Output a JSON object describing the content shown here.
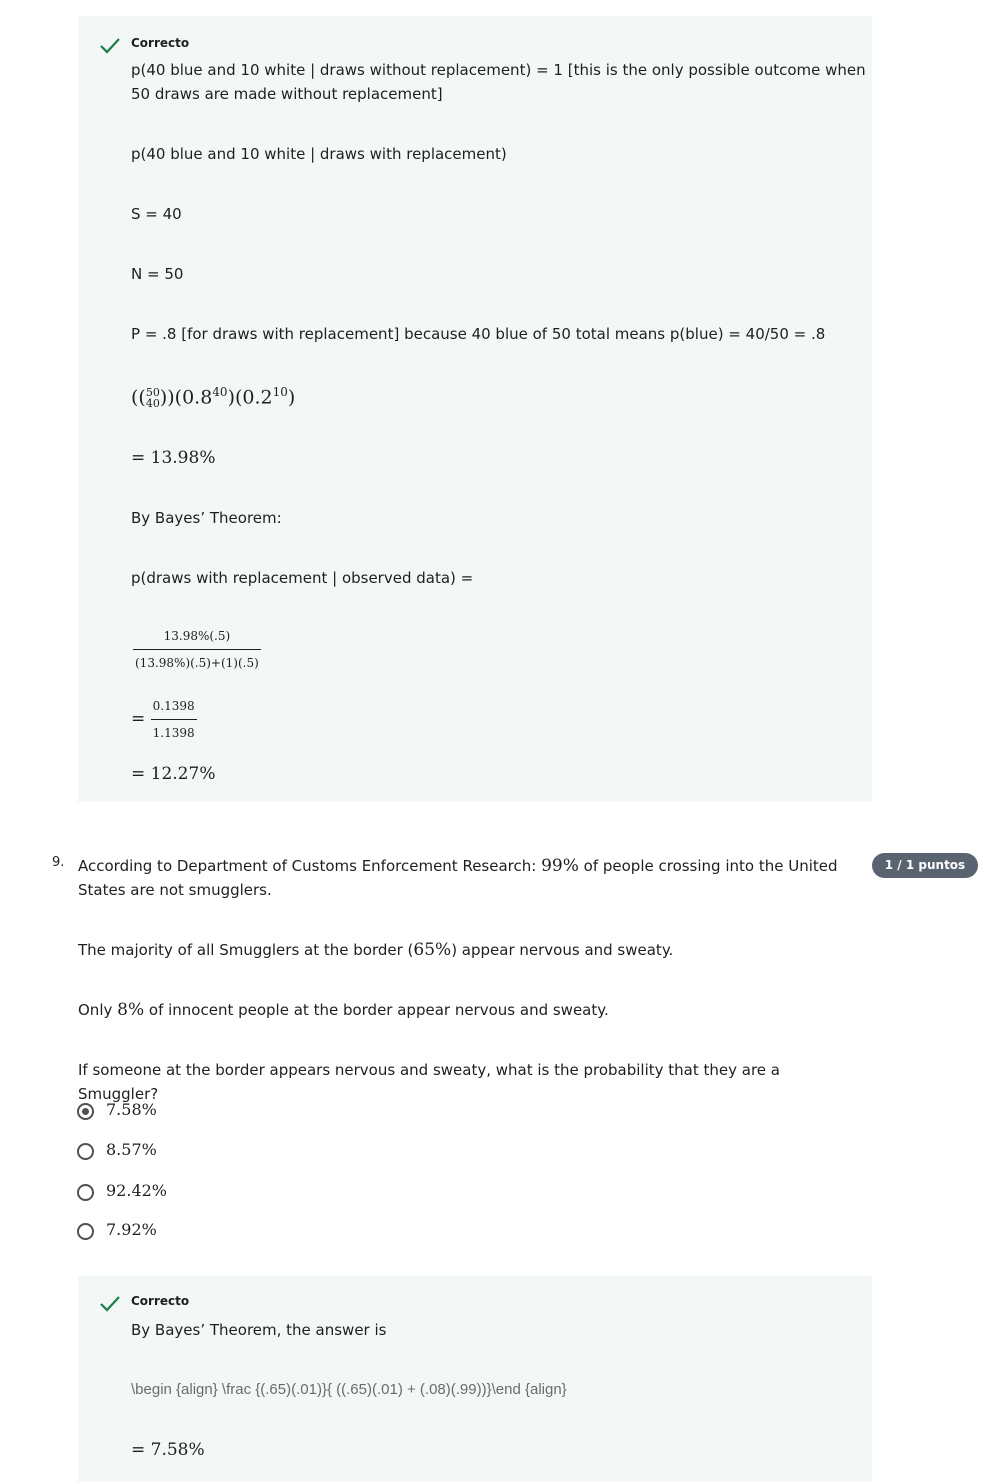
{
  "feedback1": {
    "status": "Correcto",
    "line1": "p(40 blue and 10 white | draws without replacement) = 1 [this is the only possible outcome when",
    "line1b": "50 draws are made without replacement]",
    "line2": "p(40 blue and 10 white | draws with replacement)",
    "line3": "S = 40",
    "line4": "N = 50",
    "line5": "P = .8 [for draws with replacement] because 40 blue of 50 total means p(blue) = 40/50 = .8",
    "binom_top": "50",
    "binom_bottom": "40",
    "formula_rest": ")(0.8",
    "exp1": "40",
    "formula_mid": ")(0.2",
    "exp2": "10",
    "formula_end": ")",
    "result1": "= 13.98%",
    "bayes": "By Bayes’ Theorem:",
    "posterior": "p(draws with replacement | observed data) =",
    "frac1_num": "13.98%(.5)",
    "frac1_den": "(13.98%)(.5)+(1)(.5)",
    "frac2_num": "0.1398",
    "frac2_den": "1.1398",
    "result2": "= 12.27%"
  },
  "question9": {
    "number": "9.",
    "points": "1 / 1 puntos",
    "text1a": "According to Department of Customs Enforcement Research: ",
    "text1_pct": "99%",
    "text1b": " of people crossing into the United",
    "text1c": "States are not smugglers.",
    "text2a": "The majority of all Smugglers at the border (",
    "text2_pct": "65%",
    "text2b": ") appear nervous and sweaty.",
    "text3a": "Only ",
    "text3_pct": "8%",
    "text3b": " of innocent people at the border appear nervous and sweaty.",
    "text4": "If someone at the border appears nervous and sweaty, what is the probability that they are a Smuggler?",
    "options": [
      "7.58%",
      "8.57%",
      "92.42%",
      "7.92%"
    ]
  },
  "feedback2": {
    "status": "Correcto",
    "line1": "By Bayes’ Theorem, the answer is",
    "latex": "\\begin {align} \\frac {(.65)(.01)}{ ((.65)(.01) + (.08)(.99))}\\end {align}",
    "result": "= 7.58%"
  },
  "colors": {
    "check": "#1a7f4a",
    "feedback_bg": "#f3f8f6",
    "badge_bg": "#5a6470"
  }
}
